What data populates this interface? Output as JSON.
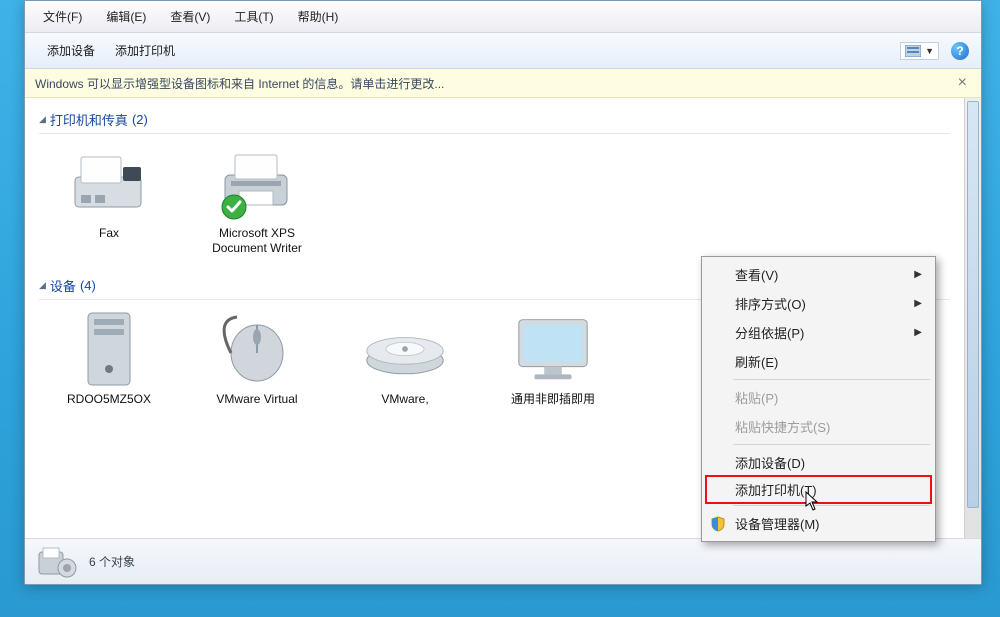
{
  "menubar": {
    "file": "文件(F)",
    "edit": "编辑(E)",
    "view": "查看(V)",
    "tools": "工具(T)",
    "help": "帮助(H)"
  },
  "toolbar": {
    "add_device": "添加设备",
    "add_printer": "添加打印机"
  },
  "infobar": {
    "message": "Windows 可以显示增强型设备图标和来自 Internet 的信息。请单击进行更改..."
  },
  "groups": {
    "printers": {
      "title": "打印机和传真",
      "count": "(2)"
    },
    "devices": {
      "title": "设备",
      "count": "(4)"
    }
  },
  "printers": [
    {
      "label": "Fax"
    },
    {
      "label": "Microsoft XPS Document Writer"
    }
  ],
  "devices": [
    {
      "label": "RDOO5MZ5OX"
    },
    {
      "label": "VMware Virtual"
    },
    {
      "label": "VMware,"
    },
    {
      "label": "通用非即插即用"
    }
  ],
  "statusbar": {
    "count_text": "6 个对象"
  },
  "context_menu": {
    "view": "查看(V)",
    "sort": "排序方式(O)",
    "group": "分组依据(P)",
    "refresh": "刷新(E)",
    "paste": "粘贴(P)",
    "paste_shortcut": "粘贴快捷方式(S)",
    "add_device": "添加设备(D)",
    "add_printer": "添加打印机(T)",
    "device_manager": "设备管理器(M)"
  }
}
